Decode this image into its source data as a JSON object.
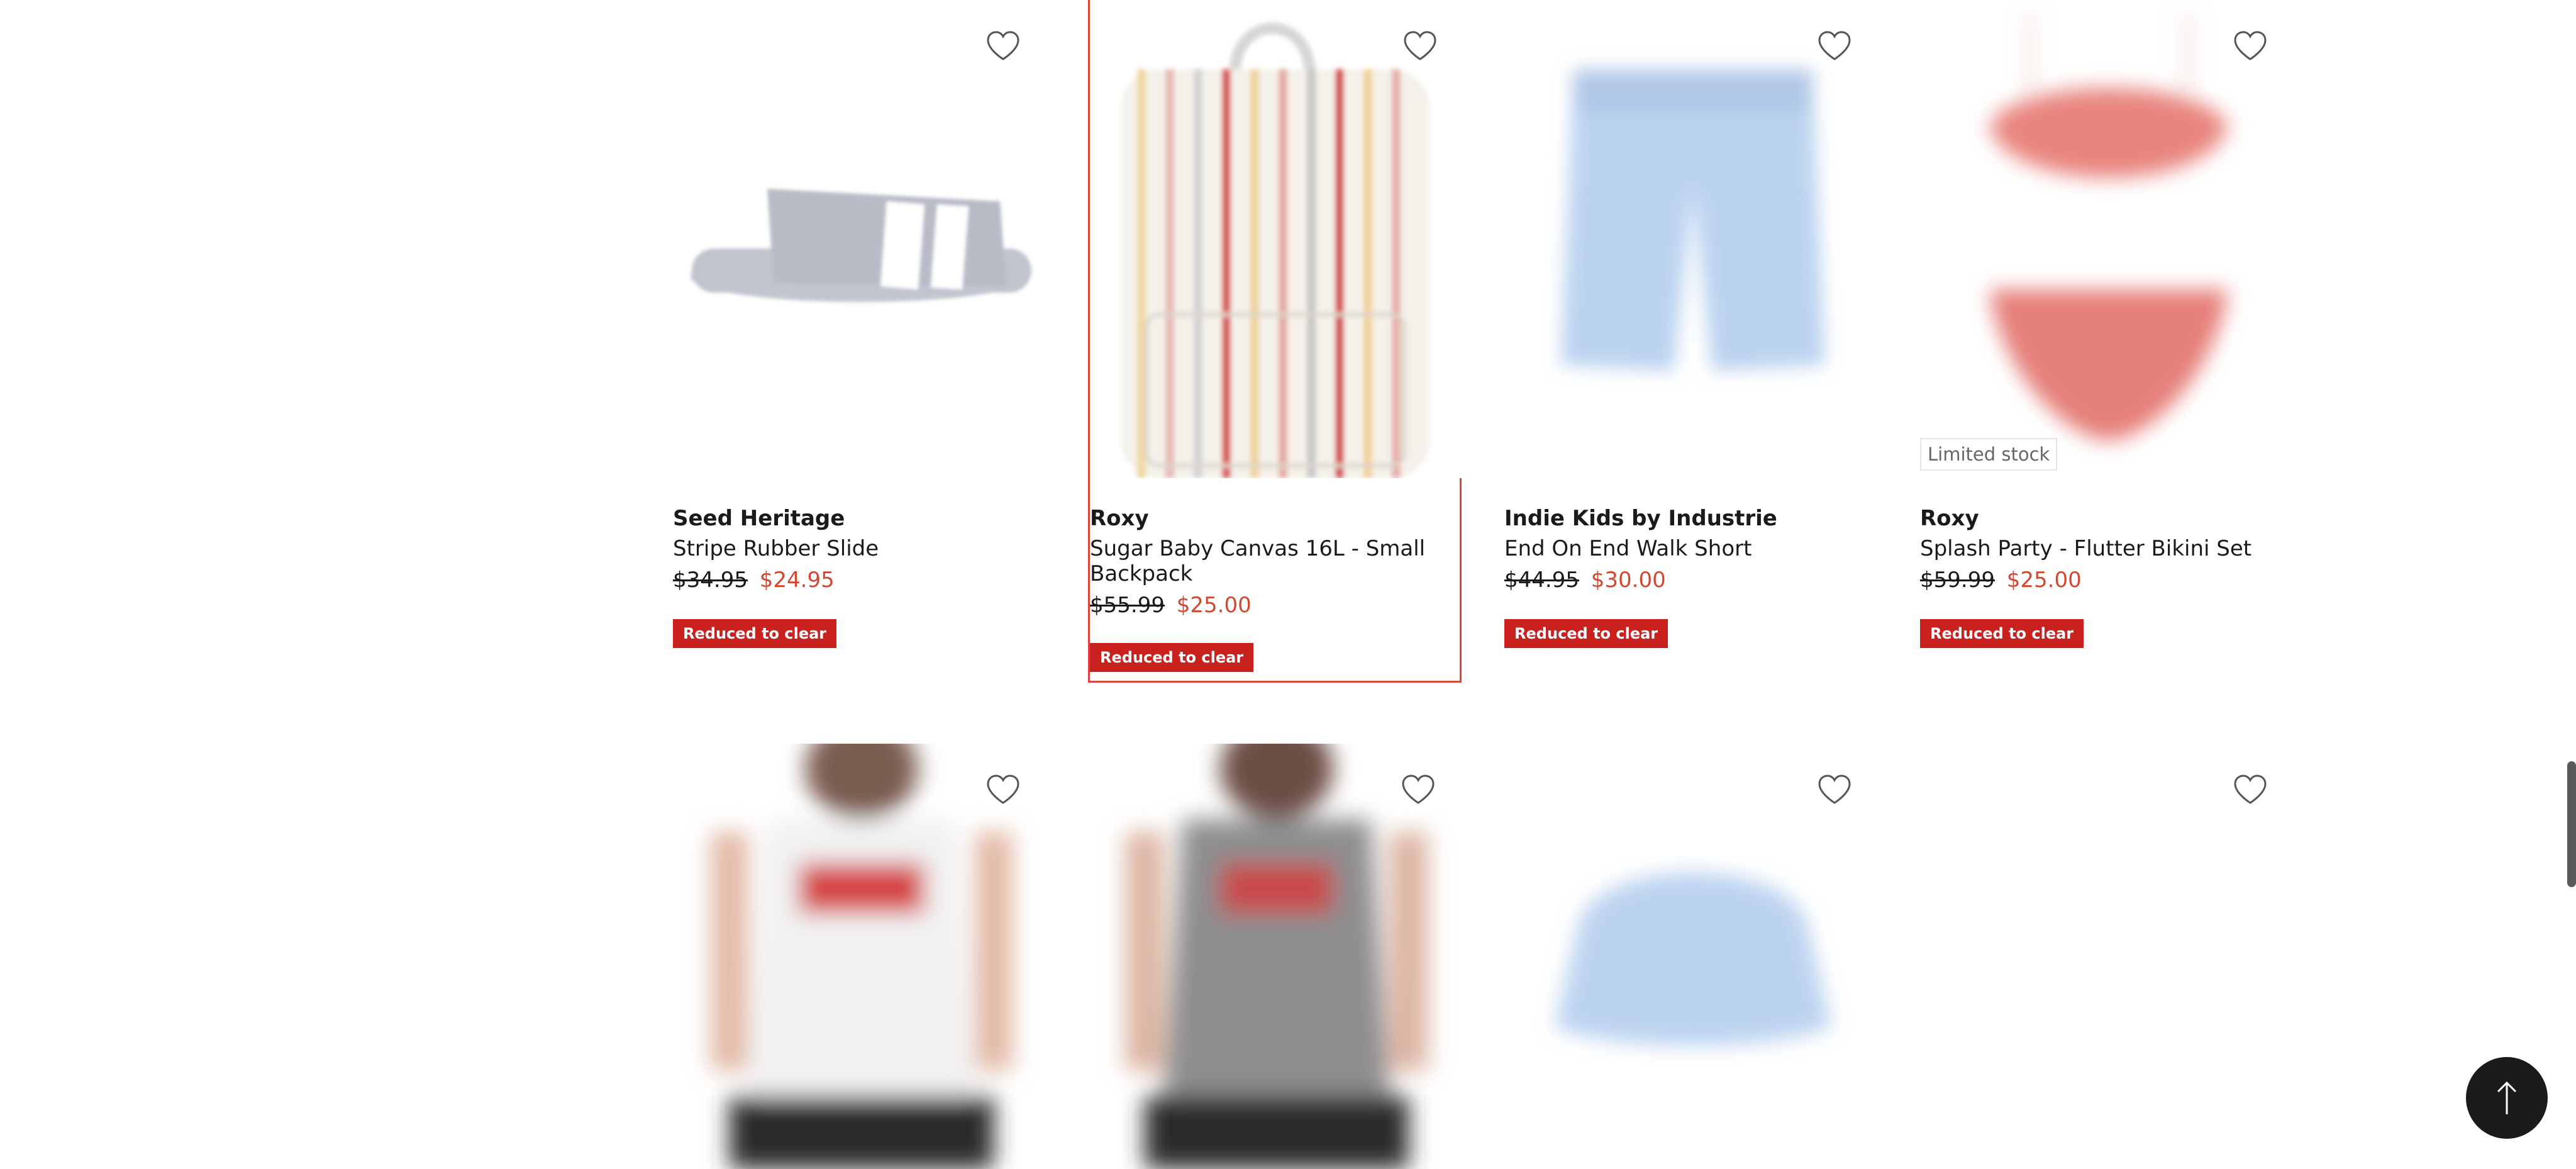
{
  "products": [
    {
      "brand": "Seed Heritage",
      "name": "Stripe Rubber Slide",
      "was": "$34.95",
      "now": "$24.95",
      "badge": "Reduced to clear"
    },
    {
      "brand": "Roxy",
      "name": "Sugar Baby Canvas 16L - Small Backpack",
      "was": "$55.99",
      "now": "$25.00",
      "badge": "Reduced to clear"
    },
    {
      "brand": "Indie Kids by Industrie",
      "name": "End On End Walk Short",
      "was": "$44.95",
      "now": "$30.00",
      "badge": "Reduced to clear"
    },
    {
      "brand": "Roxy",
      "name": "Splash Party - Flutter Bikini Set",
      "was": "$59.99",
      "now": "$25.00",
      "badge": "Reduced to clear",
      "stock_label": "Limited stock"
    }
  ],
  "colors": {
    "accent": "#c8211e",
    "sale_price": "#d3472f",
    "selection": "#e0413c"
  },
  "icons": {
    "favorite": "heart-outline-icon",
    "back_to_top": "arrow-up-icon"
  }
}
